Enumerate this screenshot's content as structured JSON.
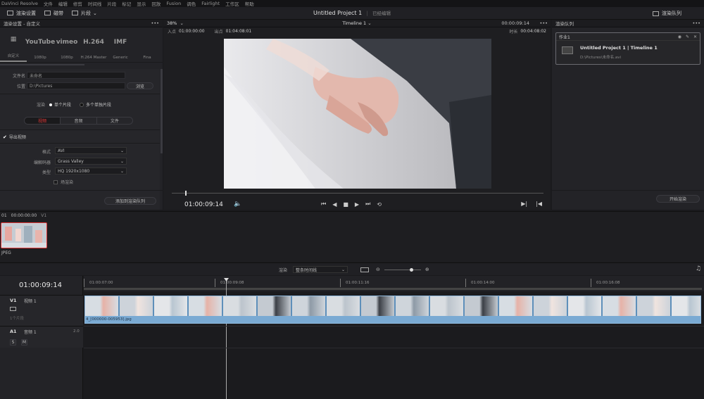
{
  "menu": [
    "DaVinci Resolve",
    "文件",
    "编辑",
    "修剪",
    "时间线",
    "片段",
    "标记",
    "显示",
    "回放",
    "Fusion",
    "调色",
    "Fairlight",
    "工作区",
    "帮助"
  ],
  "toolbar": {
    "render_settings": "渲染设置",
    "clips": "磁带",
    "clip": "片段",
    "project_title": "Untitled Project 1",
    "project_status": "已经编辑",
    "render_queue": "渲染队列"
  },
  "render_panel": {
    "header": "渲染设置 - 自定义",
    "presets": [
      {
        "logo": "▦",
        "label": "自定义"
      },
      {
        "logo": "YouTube",
        "label": "1080p"
      },
      {
        "logo": "vimeo",
        "label": "1080p"
      },
      {
        "logo": "H.264",
        "label": "H.264 Master"
      },
      {
        "logo": "IMF",
        "label": "Generic"
      },
      {
        "logo": "",
        "label": "Fina"
      }
    ],
    "filename_label": "文件名",
    "filename_value": "未命名",
    "location_label": "位置",
    "location_value": "D:\\Pictures",
    "browse": "浏览",
    "render_label": "渲染",
    "single_clip": "单个片段",
    "multi_clip": "多个单独片段",
    "tabs": [
      "视频",
      "音频",
      "文件"
    ],
    "export_video": "导出视频",
    "format_label": "格式",
    "format_value": "AVI",
    "codec_label": "编解码器",
    "codec_value": "Grass Valley",
    "type_label": "类型",
    "type_value": "HQ 1920x1080",
    "field_render": "场渲染",
    "add_to_queue": "添加到渲染队列"
  },
  "viewer": {
    "zoom": "38%",
    "timeline_name": "Timeline 1",
    "timecode_top": "00:00:09:14",
    "in_label": "入点",
    "in_value": "01:00:00:00",
    "out_label": "出点",
    "out_value": "01:04:08:01",
    "duration_label": "时长",
    "duration_value": "00:04:08:02",
    "current_tc": "01:00:09:14"
  },
  "queue": {
    "header": "渲染队列",
    "job_label": "作业1",
    "job_title": "Untitled Project 1 | Timeline 1",
    "job_path": "D:\\Pictures\\未命名.avi",
    "start_render": "开始渲染"
  },
  "media": {
    "index": "01",
    "timecode": "00:00:00:00",
    "track": "V1",
    "clip_label": "JPEG"
  },
  "timeline": {
    "render_label": "渲染",
    "render_mode": "整条时间线",
    "current_tc": "01:00:09:14",
    "ruler": [
      "01:00:07:00",
      "01:00:09:08",
      "01:00:11:16",
      "01:00:14:00",
      "01:00:16:08"
    ],
    "v1": "V1",
    "v1_name": "视频 1",
    "v1_count": "1个片段",
    "a1": "A1",
    "a1_name": "音频 1",
    "a1_ch": "2.0",
    "solo": "S",
    "mute": "M",
    "clip_name": "4_[000000-005953].jpg"
  },
  "colors": {
    "accent_red": "#e03535",
    "clip_blue": "#6fa0cc"
  }
}
